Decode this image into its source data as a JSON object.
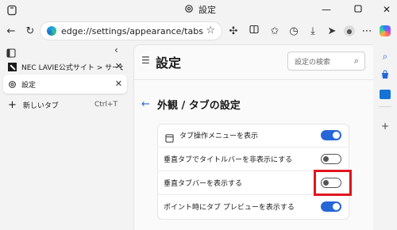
{
  "window": {
    "title": "設定"
  },
  "address": {
    "url": "edge://settings/appearance/tabs"
  },
  "tabs": [
    {
      "label": "NEC LAVIE公式サイト > サービス&サ"
    },
    {
      "label": "設定"
    }
  ],
  "new_tab": {
    "label": "新しいタブ",
    "shortcut": "Ctrl+T"
  },
  "settings": {
    "header_title": "設定",
    "search_placeholder": "設定の検索",
    "section_title": "外観 / タブの設定",
    "rows": [
      {
        "label": "タブ操作メニューを表示",
        "enabled": true
      },
      {
        "label": "垂直タブでタイトルバーを非表示にする",
        "enabled": false
      },
      {
        "label": "垂直タブバーを表示する",
        "enabled": false
      },
      {
        "label": "ポイント時にタブ プレビューを表示する",
        "enabled": true
      }
    ]
  },
  "colors": {
    "accent": "#2766d6",
    "highlight": "#e0161e"
  }
}
